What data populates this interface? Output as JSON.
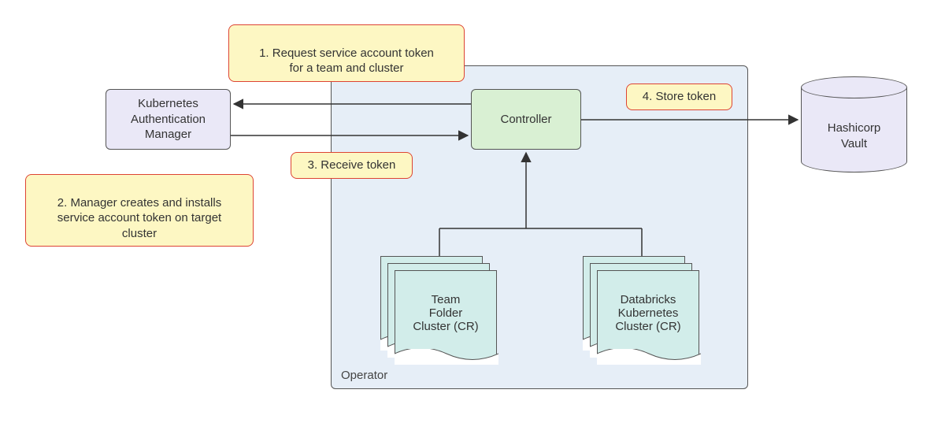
{
  "operator_label": "Operator",
  "nodes": {
    "kam": "Kubernetes\nAuthentication\nManager",
    "controller": "Controller",
    "vault": "Hashicorp\nVault",
    "team_cr": "Team\nFolder\nCluster (CR)",
    "dbk_cr": "Databricks\nKubernetes\nCluster (CR)"
  },
  "callouts": {
    "step1": "1. Request service account token\nfor a team and cluster",
    "step2": "2. Manager creates and installs\nservice account token on target\ncluster",
    "step3": "3. Receive token",
    "step4": "4. Store token"
  }
}
